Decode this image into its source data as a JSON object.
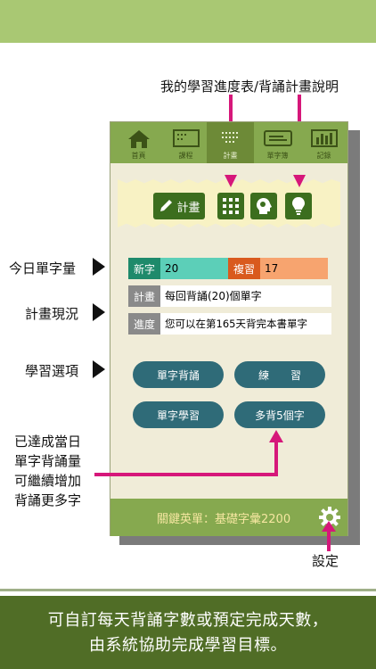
{
  "callouts": {
    "top": "我的學習進度表/背誦計畫說明",
    "today_count": "今日單字量",
    "plan_status": "計畫現況",
    "study_options": "學習選項",
    "bonus_lines": [
      "已達成當日",
      "單字背誦量",
      "可繼續增加",
      "背誦更多字"
    ],
    "settings": "設定"
  },
  "tabs": [
    {
      "label": "首頁",
      "icon": "home-icon"
    },
    {
      "label": "課程",
      "icon": "lessons-icon"
    },
    {
      "label": "計畫",
      "icon": "plan-icon"
    },
    {
      "label": "單字簿",
      "icon": "wordbook-icon"
    },
    {
      "label": "記錄",
      "icon": "records-icon"
    }
  ],
  "toolbar": {
    "plan_label": "計畫"
  },
  "stats": {
    "new_label": "新字",
    "new_value": "20",
    "review_label": "複習",
    "review_value": "17",
    "plan_label": "計畫",
    "plan_value": "每回背誦(20)個單字",
    "progress_label": "進度",
    "progress_value": "您可以在第165天背完本書單字"
  },
  "actions": {
    "memorize": "單字背誦",
    "practice": "練　　習",
    "learn": "單字學習",
    "more": "多背5個字"
  },
  "footer": {
    "book": "關鍵英單：基礎字彙2200"
  },
  "caption": [
    "可自訂每天背誦字數或預定完成天數，",
    "由系統協助完成學習目標。"
  ],
  "colors": {
    "new": "#5ccfb8",
    "review": "#f7a46f",
    "accent": "#d6177a"
  }
}
